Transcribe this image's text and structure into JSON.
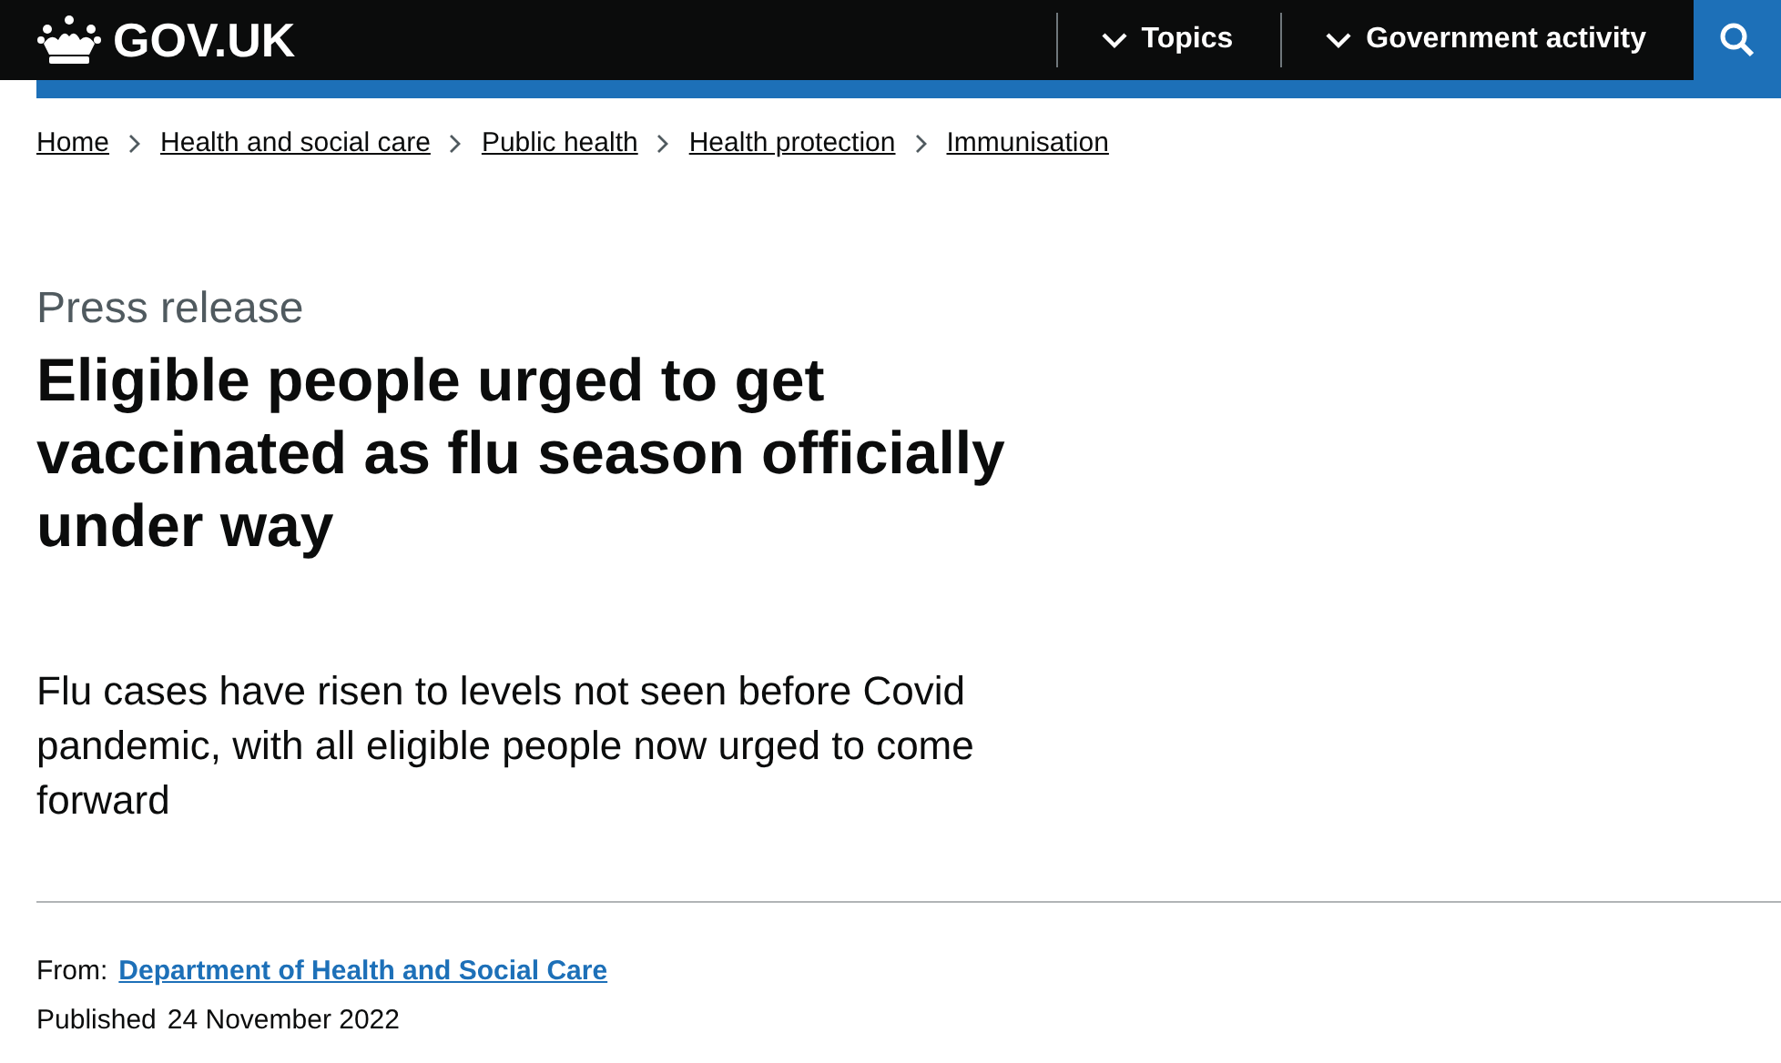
{
  "header": {
    "logo": "GOV.UK",
    "nav": [
      {
        "label": "Topics"
      },
      {
        "label": "Government activity"
      }
    ]
  },
  "breadcrumbs": [
    "Home",
    "Health and social care",
    "Public health",
    "Health protection",
    "Immunisation"
  ],
  "article": {
    "caption": "Press release",
    "title": "Eligible people urged to get vaccinated as flu season officially under way",
    "lead": "Flu cases have risen to levels not seen before Covid pandemic, with all eligible people now urged to come forward",
    "from_label": "From:",
    "from_link": "Department of Health and Social Care",
    "published_label": "Published",
    "published_date": "24 November 2022"
  }
}
